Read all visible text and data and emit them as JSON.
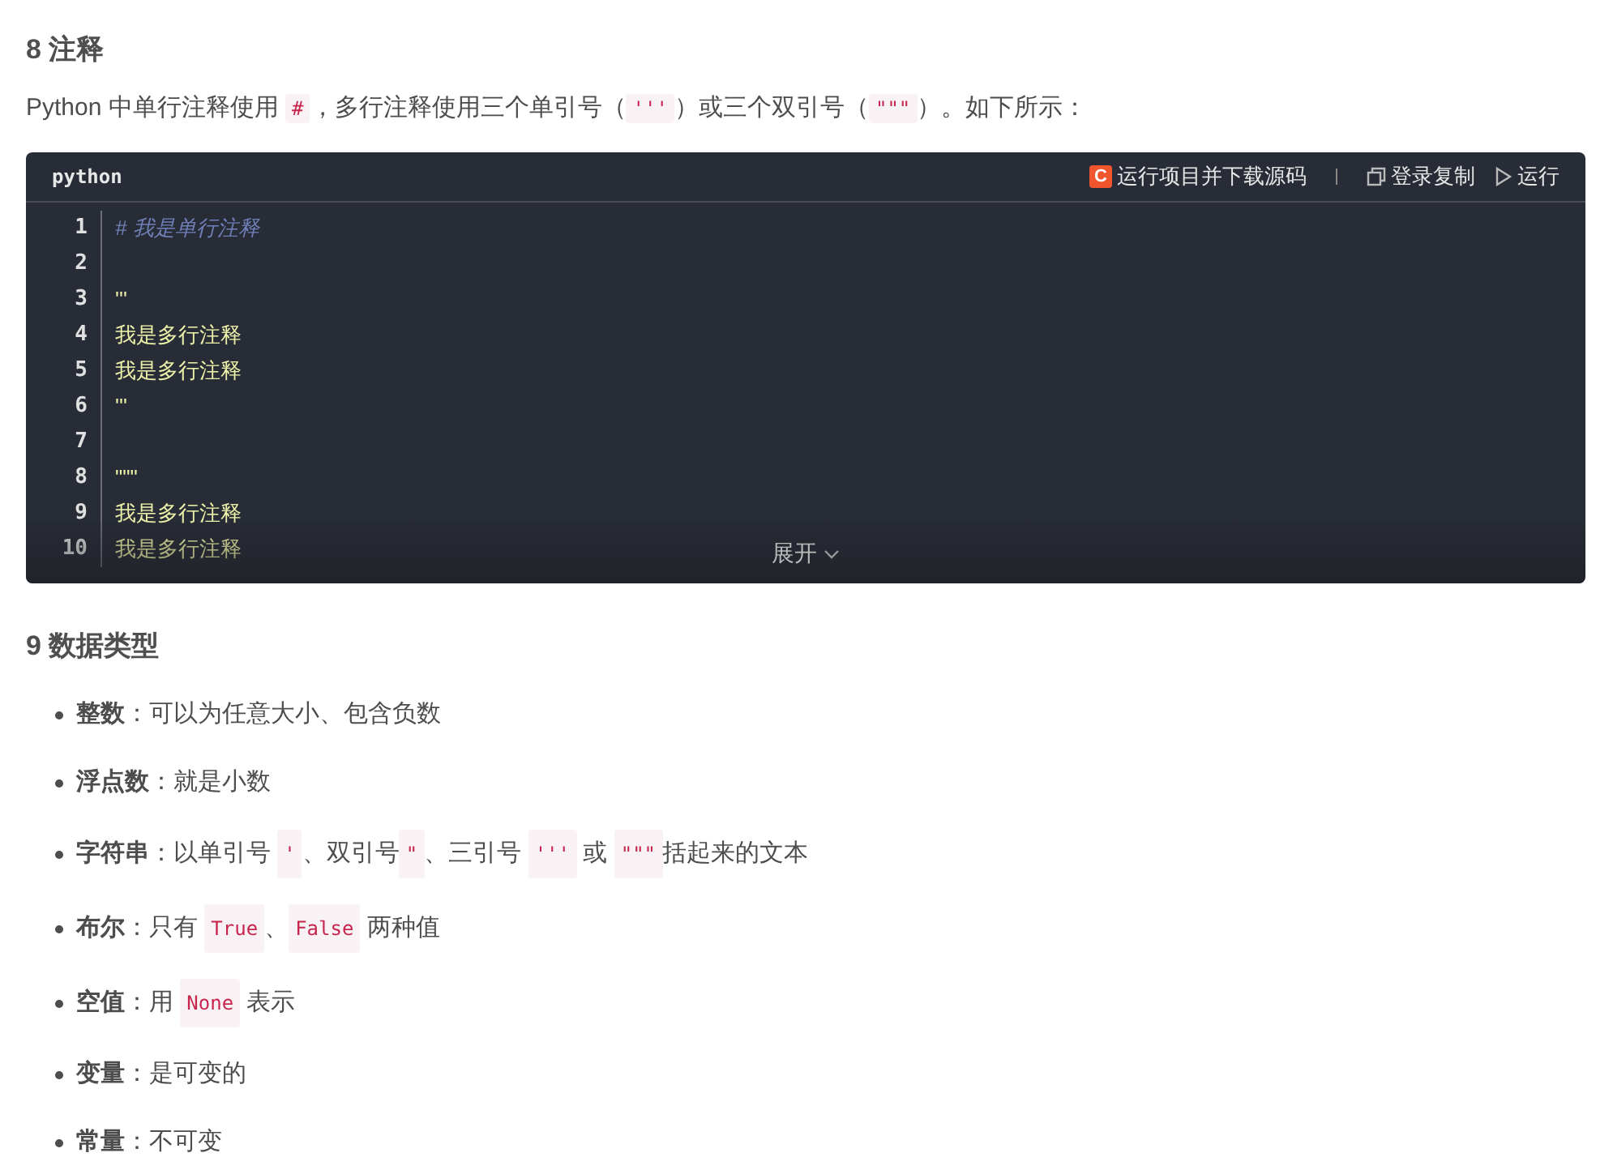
{
  "sections": [
    {
      "heading": "8 注释",
      "paragraph": [
        {
          "kind": "text",
          "text": "Python 中单行注释使用 "
        },
        {
          "kind": "code",
          "text": "#"
        },
        {
          "kind": "text",
          "text": "，多行注释使用三个单引号（"
        },
        {
          "kind": "code",
          "text": "'''"
        },
        {
          "kind": "text",
          "text": "）或三个双引号（"
        },
        {
          "kind": "code",
          "text": "\"\"\""
        },
        {
          "kind": "text",
          "text": "）。如下所示："
        }
      ],
      "code_block": {
        "language": "python",
        "actions": [
          {
            "kind": "logo",
            "logo_letter": "C",
            "label": "运行项目并下载源码"
          },
          {
            "kind": "copy",
            "label": "登录复制"
          },
          {
            "kind": "run",
            "label": "运行"
          }
        ],
        "lines": [
          {
            "number": "1",
            "kind": "comment",
            "text": "# 我是单行注释"
          },
          {
            "number": "2",
            "kind": "blank"
          },
          {
            "number": "3",
            "kind": "string",
            "text": "'''"
          },
          {
            "number": "4",
            "kind": "string",
            "text": "我是多行注释"
          },
          {
            "number": "5",
            "kind": "string",
            "text": "我是多行注释"
          },
          {
            "number": "6",
            "kind": "string",
            "text": "'''"
          },
          {
            "number": "7",
            "kind": "blank"
          },
          {
            "number": "8",
            "kind": "string",
            "text": "\"\"\""
          },
          {
            "number": "9",
            "kind": "string",
            "text": "我是多行注释"
          },
          {
            "number": "10",
            "kind": "string",
            "text": "我是多行注释"
          }
        ],
        "expand_label": "展开"
      }
    },
    {
      "heading": "9 数据类型",
      "items": [
        {
          "term": "整数",
          "segments": [
            {
              "kind": "text",
              "text": "：可以为任意大小、包含负数"
            }
          ]
        },
        {
          "term": "浮点数",
          "segments": [
            {
              "kind": "text",
              "text": "：就是小数"
            }
          ]
        },
        {
          "term": "字符串",
          "segments": [
            {
              "kind": "text",
              "text": "：以单引号 "
            },
            {
              "kind": "code",
              "text": "'"
            },
            {
              "kind": "text",
              "text": "、双引号"
            },
            {
              "kind": "code",
              "text": "\""
            },
            {
              "kind": "text",
              "text": "、三引号 "
            },
            {
              "kind": "code",
              "text": "'''"
            },
            {
              "kind": "text",
              "text": " 或 "
            },
            {
              "kind": "code",
              "text": "\"\"\""
            },
            {
              "kind": "text",
              "text": "括起来的文本"
            }
          ]
        },
        {
          "term": "布尔",
          "segments": [
            {
              "kind": "text",
              "text": "：只有 "
            },
            {
              "kind": "code",
              "text": "True"
            },
            {
              "kind": "text",
              "text": "、"
            },
            {
              "kind": "code",
              "text": "False"
            },
            {
              "kind": "text",
              "text": " 两种值"
            }
          ]
        },
        {
          "term": "空值",
          "segments": [
            {
              "kind": "text",
              "text": "：用 "
            },
            {
              "kind": "code",
              "text": "None"
            },
            {
              "kind": "text",
              "text": " 表示"
            }
          ]
        },
        {
          "term": "变量",
          "segments": [
            {
              "kind": "text",
              "text": "：是可变的"
            }
          ]
        },
        {
          "term": "常量",
          "segments": [
            {
              "kind": "text",
              "text": "：不可变"
            }
          ]
        }
      ]
    }
  ]
}
